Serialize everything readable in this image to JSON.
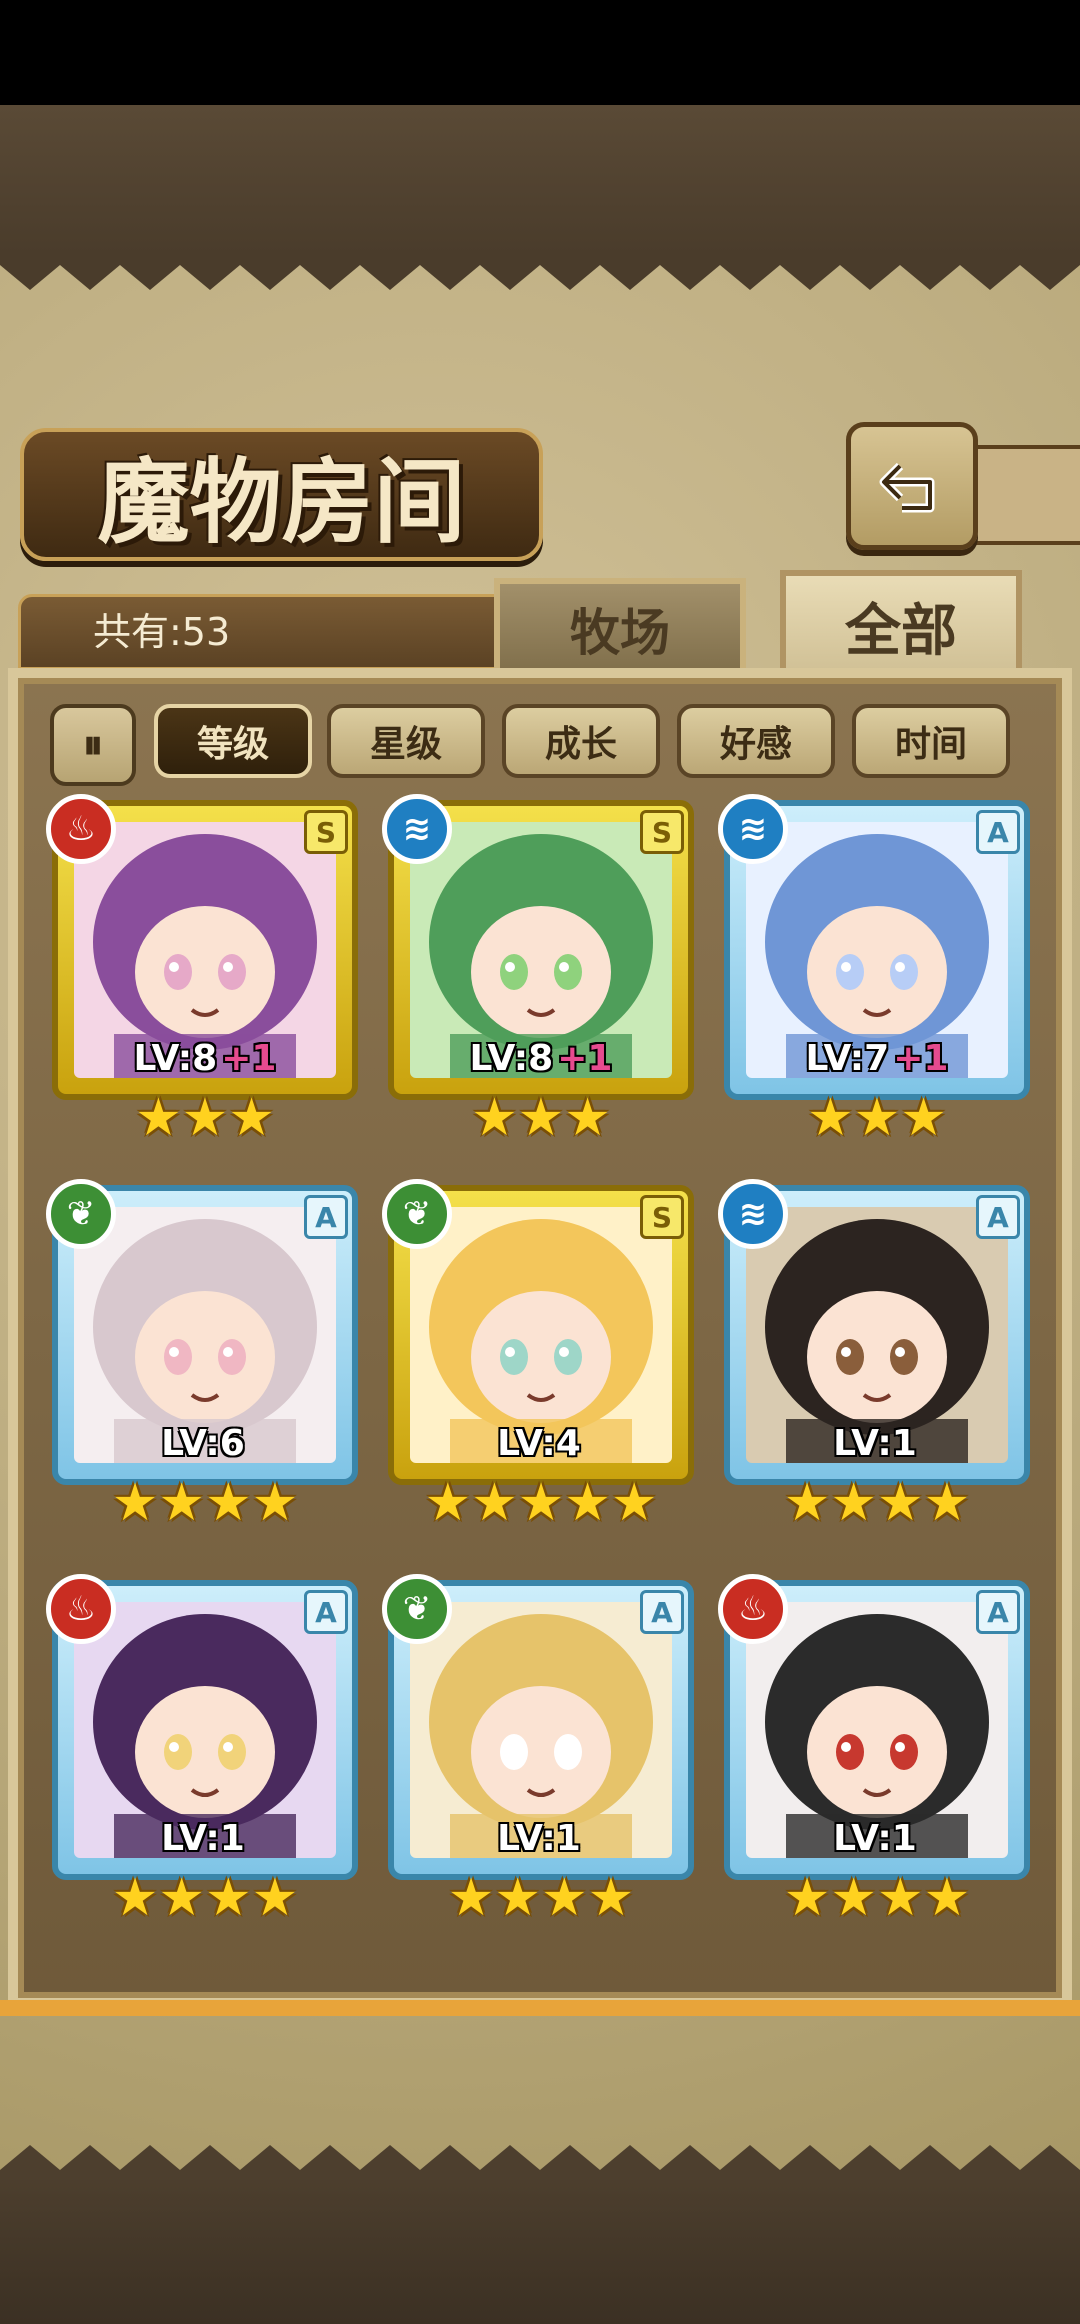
{
  "title": "魔物房间",
  "count_label": "共有:53",
  "tabs": [
    {
      "label": "牧场"
    },
    {
      "label": "全部"
    }
  ],
  "sort_toggle_icon": "pause-like-icon",
  "sort_buttons": [
    {
      "label": "等级",
      "active": true
    },
    {
      "label": "星级",
      "active": false
    },
    {
      "label": "成长",
      "active": false
    },
    {
      "label": "好感",
      "active": false
    },
    {
      "label": "时间",
      "active": false
    }
  ],
  "monsters": [
    {
      "element": "fire",
      "rank": "S",
      "level": "LV:8",
      "bonus": "+1",
      "stars": "★★★",
      "star_count": 3,
      "colors": [
        "#f4d6e5",
        "#8a4e9c",
        "#e6a9c8"
      ]
    },
    {
      "element": "water",
      "rank": "S",
      "level": "LV:8",
      "bonus": "+1",
      "stars": "★★★",
      "star_count": 3,
      "colors": [
        "#c9eab7",
        "#4f9e5a",
        "#8fd27d"
      ]
    },
    {
      "element": "water",
      "rank": "A",
      "level": "LV:7",
      "bonus": "+1",
      "stars": "★★★",
      "star_count": 3,
      "colors": [
        "#e8f1ff",
        "#6f96d6",
        "#b7cdf6"
      ]
    },
    {
      "element": "leaf",
      "rank": "A",
      "level": "LV:6",
      "bonus": "",
      "stars": "★★★★",
      "star_count": 4,
      "colors": [
        "#f5eef0",
        "#d8c8ce",
        "#f0b7c3"
      ]
    },
    {
      "element": "leaf",
      "rank": "S",
      "level": "LV:4",
      "bonus": "",
      "stars": "★★★★★",
      "star_count": 5,
      "colors": [
        "#fff1c8",
        "#f3c65b",
        "#9ed6c8"
      ]
    },
    {
      "element": "water",
      "rank": "A",
      "level": "LV:1",
      "bonus": "",
      "stars": "★★★★",
      "star_count": 4,
      "colors": [
        "#d9cbb1",
        "#2c2420",
        "#8a5e3b"
      ]
    },
    {
      "element": "fire",
      "rank": "A",
      "level": "LV:1",
      "bonus": "",
      "stars": "★★★★",
      "star_count": 4,
      "colors": [
        "#e7d8f1",
        "#4a2a5e",
        "#f1d37a"
      ]
    },
    {
      "element": "leaf",
      "rank": "A",
      "level": "LV:1",
      "bonus": "",
      "stars": "★★★★",
      "star_count": 4,
      "colors": [
        "#f6ecd2",
        "#e6c36a",
        "#ffffff"
      ]
    },
    {
      "element": "fire",
      "rank": "A",
      "level": "LV:1",
      "bonus": "",
      "stars": "★★★★",
      "star_count": 4,
      "colors": [
        "#f2eeee",
        "#2b2b2b",
        "#c7382f"
      ]
    }
  ],
  "element_glyphs": {
    "fire": "♨",
    "water": "≋",
    "leaf": "❦"
  }
}
